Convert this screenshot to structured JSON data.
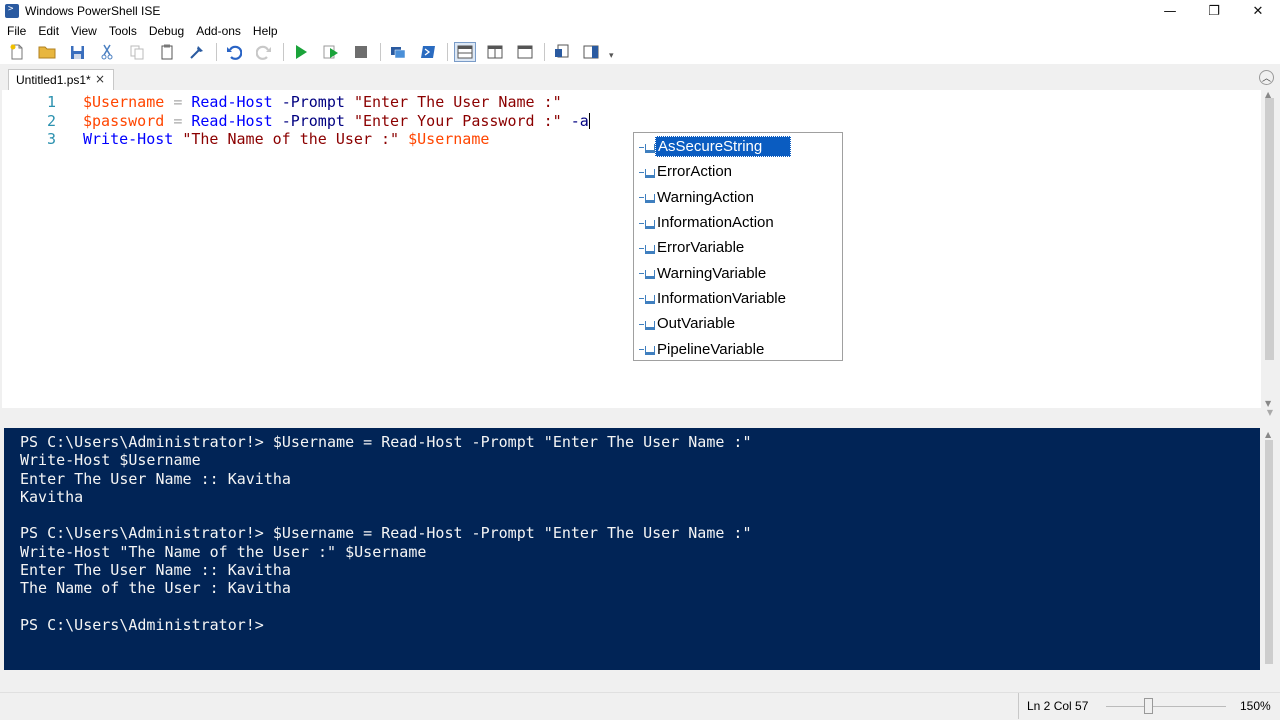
{
  "window": {
    "title": "Windows PowerShell ISE",
    "controls": [
      "—",
      "❐",
      "✕"
    ]
  },
  "menu": [
    "File",
    "Edit",
    "View",
    "Tools",
    "Debug",
    "Add-ons",
    "Help"
  ],
  "toolbar": {
    "icons": [
      "new-file",
      "open-file",
      "save",
      "cut",
      "copy",
      "paste",
      "clear",
      "undo",
      "redo",
      "run",
      "run-selection",
      "stop",
      "remote-powershell",
      "start-powershell",
      "show-script-pane-top",
      "show-script-pane-right",
      "show-script-pane-maximized",
      "show-command-window",
      "show-command-addon"
    ]
  },
  "tab": {
    "label": "Untitled1.ps1*",
    "close": "×"
  },
  "editor": {
    "line_numbers": [
      "1",
      "2",
      "3"
    ],
    "lines": [
      [
        {
          "t": "$Username",
          "c": "var"
        },
        {
          "t": " ",
          "c": ""
        },
        {
          "t": "=",
          "c": "op"
        },
        {
          "t": " ",
          "c": ""
        },
        {
          "t": "Read-Host",
          "c": "cmd"
        },
        {
          "t": " ",
          "c": ""
        },
        {
          "t": "-Prompt",
          "c": "param"
        },
        {
          "t": " ",
          "c": ""
        },
        {
          "t": "\"Enter The User Name :\"",
          "c": "str"
        }
      ],
      [
        {
          "t": "$password",
          "c": "var"
        },
        {
          "t": " ",
          "c": ""
        },
        {
          "t": "=",
          "c": "op"
        },
        {
          "t": " ",
          "c": ""
        },
        {
          "t": "Read-Host",
          "c": "cmd"
        },
        {
          "t": " ",
          "c": ""
        },
        {
          "t": "-Prompt",
          "c": "param"
        },
        {
          "t": " ",
          "c": ""
        },
        {
          "t": "\"Enter Your Password :\"",
          "c": "str"
        },
        {
          "t": " ",
          "c": ""
        },
        {
          "t": "-a",
          "c": "param"
        }
      ],
      [
        {
          "t": "Write-Host",
          "c": "cmd"
        },
        {
          "t": " ",
          "c": ""
        },
        {
          "t": "\"The Name of the User :\"",
          "c": "str"
        },
        {
          "t": " ",
          "c": ""
        },
        {
          "t": "$Username",
          "c": "var"
        }
      ]
    ]
  },
  "autocomplete": {
    "selected": "AsSecureString",
    "items": [
      "AsSecureString",
      "ErrorAction",
      "WarningAction",
      "InformationAction",
      "ErrorVariable",
      "WarningVariable",
      "InformationVariable",
      "OutVariable",
      "PipelineVariable"
    ]
  },
  "console": {
    "lines": [
      "PS C:\\Users\\Administrator!> $Username = Read-Host -Prompt \"Enter The User Name :\"",
      "Write-Host $Username",
      "Enter The User Name :: Kavitha",
      "Kavitha",
      "",
      "PS C:\\Users\\Administrator!> $Username = Read-Host -Prompt \"Enter The User Name :\"",
      "Write-Host \"The Name of the User :\" $Username",
      "Enter The User Name :: Kavitha",
      "The Name of the User : Kavitha",
      "",
      "PS C:\\Users\\Administrator!>"
    ]
  },
  "status": {
    "position": "Ln 2  Col 57",
    "zoom": "150%",
    "zoom_level_percent": 150
  },
  "colors": {
    "console_bg": "#012456",
    "variable": "#ff4500",
    "cmdlet": "#0000ff",
    "parameter": "#000080",
    "string": "#8b0000",
    "selection": "#0a5cc1"
  }
}
